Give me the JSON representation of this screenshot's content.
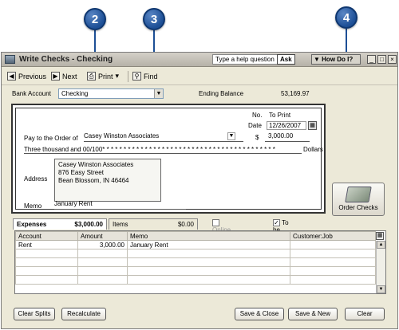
{
  "callouts": [
    "2",
    "3",
    "4"
  ],
  "window": {
    "title": "Write Checks - Checking",
    "help_prompt": "Type a help question",
    "ask_label": "Ask",
    "how_do_i_label": "How Do I?"
  },
  "toolbar": {
    "previous": "Previous",
    "next": "Next",
    "print": "Print",
    "find": "Find"
  },
  "bank": {
    "label": "Bank Account",
    "account": "Checking",
    "ending_balance_label": "Ending Balance",
    "ending_balance": "53,169.97"
  },
  "check": {
    "no_label": "No.",
    "no_value": "To Print",
    "date_label": "Date",
    "date_value": "12/26/2007",
    "pay_to_label": "Pay to the Order of",
    "payee": "Casey Winston Associates",
    "currency_symbol": "$",
    "amount": "3,000.00",
    "amount_words": "Three thousand  and 00/100* * * * * * * * * * * * * * * * * * * * * * * * * * * * * * * * * * * * * * * * *",
    "dollars_label": "Dollars",
    "address_label": "Address",
    "address_lines": [
      "Casey Winston Associates",
      "876 Easy Street",
      "Bean Blossom, IN 46464"
    ],
    "memo_label": "Memo",
    "memo": "January Rent"
  },
  "order_checks_label": "Order Checks",
  "tabs": {
    "expenses_label": "Expenses",
    "expenses_amount": "$3,000.00",
    "items_label": "Items",
    "items_amount": "$0.00",
    "online_payment": "Online Payment",
    "to_be_printed": "To be printed"
  },
  "grid": {
    "headers": [
      "Account",
      "Amount",
      "Memo",
      "Customer:Job"
    ],
    "rows": [
      {
        "account": "Rent",
        "amount": "3,000.00",
        "memo": "January Rent",
        "job": ""
      }
    ]
  },
  "buttons": {
    "clear_splits": "Clear Splits",
    "recalculate": "Recalculate",
    "save_close": "Save & Close",
    "save_new": "Save & New",
    "clear": "Clear"
  }
}
